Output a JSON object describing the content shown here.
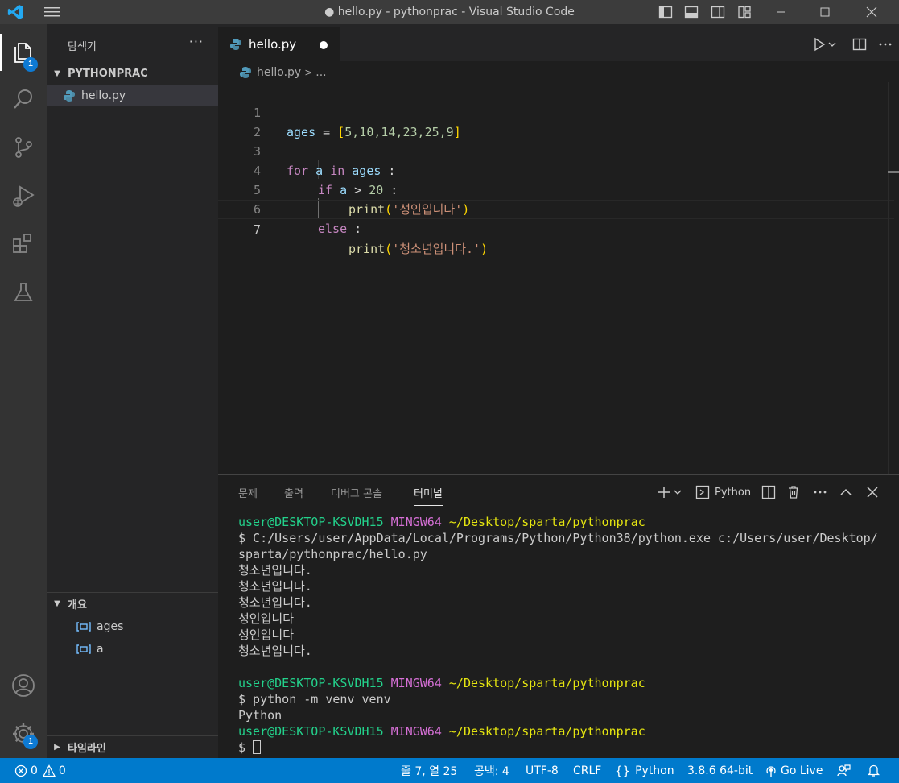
{
  "titlebar": {
    "title": "● hello.py - pythonprac - Visual Studio Code"
  },
  "activitybar": {
    "explorer_badge": "1",
    "settings_badge": "1"
  },
  "sidebar": {
    "title": "탐색기",
    "more": "···",
    "folder_name": "PYTHONPRAC",
    "file_name": "hello.py",
    "outline_title": "개요",
    "outline_items": [
      "ages",
      "a"
    ],
    "timeline_title": "타임라인"
  },
  "tabs": {
    "active_label": "hello.py"
  },
  "breadcrumb": {
    "file": "hello.py",
    "rest": "..."
  },
  "editor": {
    "line_numbers": [
      "1",
      "2",
      "3",
      "4",
      "5",
      "6",
      "7"
    ],
    "line1": {
      "var": "ages",
      "op": " = ",
      "open": "[",
      "nums": "5,10,14,23,25,9",
      "close": "]"
    },
    "line3": {
      "kw1": "for",
      "v1": " a ",
      "kw2": "in",
      "v2": " ages",
      "rest": " :"
    },
    "line4": {
      "kw": "if",
      "var": " a",
      "op": " > ",
      "num": "20",
      "rest": " :"
    },
    "line5": {
      "fn": "print",
      "open": "(",
      "str": "'성인입니다'",
      "close": ")"
    },
    "line6": {
      "kw": "else",
      "rest": " :"
    },
    "line7": {
      "fn": "print",
      "open": "(",
      "str": "'청소년입니다.'",
      "close": ")"
    }
  },
  "panel": {
    "tabs": [
      "문제",
      "출력",
      "디버그 콘솔",
      "터미널"
    ],
    "terminal_profile": "Python",
    "prompt_user": "user@DESKTOP-KSVDH15",
    "prompt_env": "MINGW64",
    "prompt_path": "~/Desktop/sparta/pythonprac",
    "cmd1_a": "$ C:/Users/user/AppData/Local/Programs/Python/Python38/python.exe c:/Users/user/Desktop/",
    "cmd1_b": "sparta/pythonprac/hello.py",
    "outputs": [
      "청소년입니다.",
      "청소년입니다.",
      "청소년입니다.",
      "성인입니다",
      "성인입니다",
      "청소년입니다."
    ],
    "cmd2": "$ python -m venv venv",
    "cmd2_out": "Python",
    "cmd3": "$ "
  },
  "statusbar": {
    "errors": "0",
    "warnings": "0",
    "position": "줄 7, 열 25",
    "spaces": "공백: 4",
    "encoding": "UTF-8",
    "eol": "CRLF",
    "language": "Python",
    "interpreter": "3.8.6 64-bit",
    "golive": "Go Live"
  },
  "colors": {
    "accent": "#007acc",
    "keyword": "#c586c0",
    "variable": "#9cdcfe",
    "string": "#ce9178",
    "function": "#dcdcaa",
    "number": "#b5cea8"
  }
}
